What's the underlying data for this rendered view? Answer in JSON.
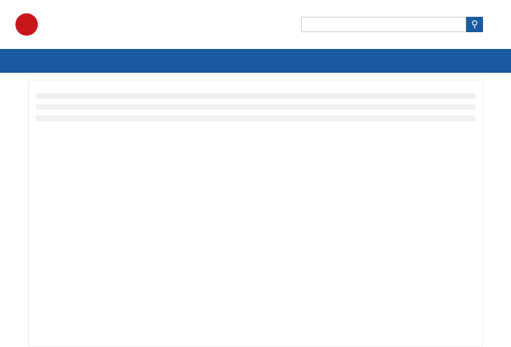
{
  "nav": [
    "",
    "",
    "",
    "",
    "",
    "",
    ""
  ]
}
